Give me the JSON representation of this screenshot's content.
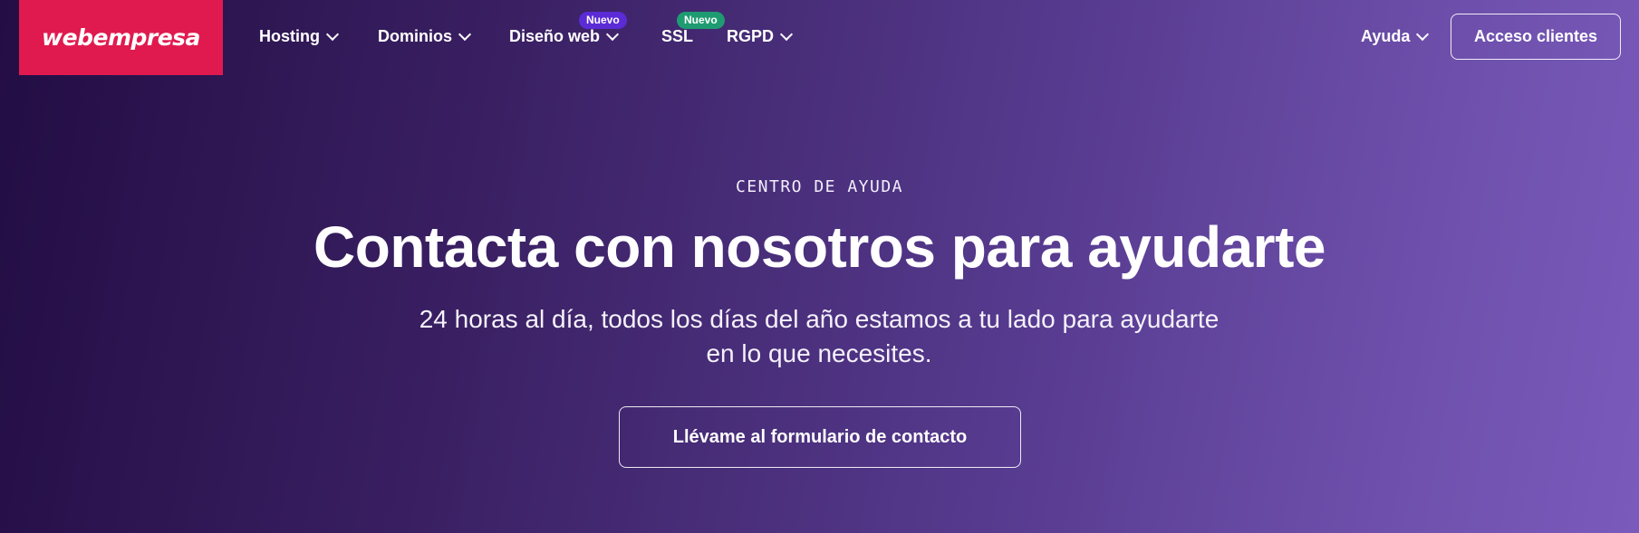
{
  "brand": {
    "logo_text": "webempresa",
    "logo_color": "#e01a4f"
  },
  "nav": {
    "items": [
      {
        "label": "Hosting",
        "has_dropdown": true
      },
      {
        "label": "Dominios",
        "has_dropdown": true
      },
      {
        "label": "Diseño web",
        "has_dropdown": true,
        "badge": "Nuevo",
        "badge_color": "#5b2bd6"
      },
      {
        "label": "SSL",
        "has_dropdown": false,
        "badge": "Nuevo",
        "badge_color": "#1f9b72"
      },
      {
        "label": "RGPD",
        "has_dropdown": true
      }
    ],
    "help": {
      "label": "Ayuda",
      "has_dropdown": true
    },
    "client_access_label": "Acceso clientes",
    "dropdown_icon": "chevron-down-icon"
  },
  "hero": {
    "eyebrow": "CENTRO DE AYUDA",
    "title": "Contacta con nosotros para ayudarte",
    "subtitle": "24 horas al día, todos los días del año estamos a tu lado para ayudarte en lo que necesites.",
    "cta_label": "Llévame al formulario de contacto"
  },
  "colors": {
    "gradient_start": "#230d44",
    "gradient_end": "#7a5abb"
  }
}
